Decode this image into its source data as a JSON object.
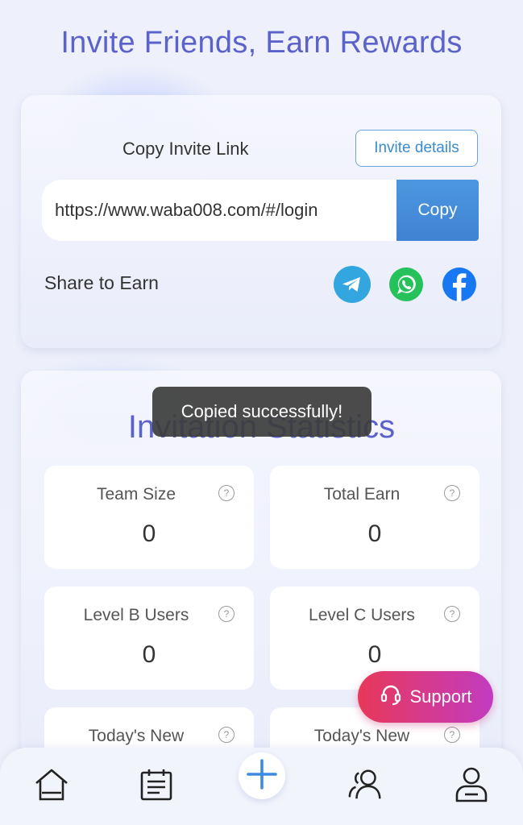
{
  "page": {
    "title": "Invite Friends, Earn Rewards"
  },
  "invite": {
    "copy_label": "Copy Invite Link",
    "details_button": "Invite details",
    "link": "https://www.waba008.com/#/login",
    "copy_button": "Copy",
    "share_label": "Share to Earn",
    "share_icons": [
      "telegram-icon",
      "whatsapp-icon",
      "facebook-icon"
    ]
  },
  "stats": {
    "title": "Invitation Statistics",
    "items": [
      {
        "label": "Team Size",
        "value": "0"
      },
      {
        "label": "Total Earn",
        "value": "0"
      },
      {
        "label": "Level B Users",
        "value": "0"
      },
      {
        "label": "Level C Users",
        "value": "0"
      },
      {
        "label": "Today's New",
        "value": ""
      },
      {
        "label": "Today's New",
        "value": ""
      }
    ]
  },
  "toast": {
    "message": "Copied successfully!"
  },
  "support": {
    "label": "Support"
  },
  "nav": {
    "items": [
      "home-icon",
      "calendar-icon",
      "plus-icon",
      "team-icon",
      "profile-icon"
    ]
  },
  "colors": {
    "title": "#5b62c9",
    "copy_button": "#4a90e2",
    "support_start": "#e8385a",
    "support_end": "#c23cc0",
    "plus": "#3d8be0"
  }
}
